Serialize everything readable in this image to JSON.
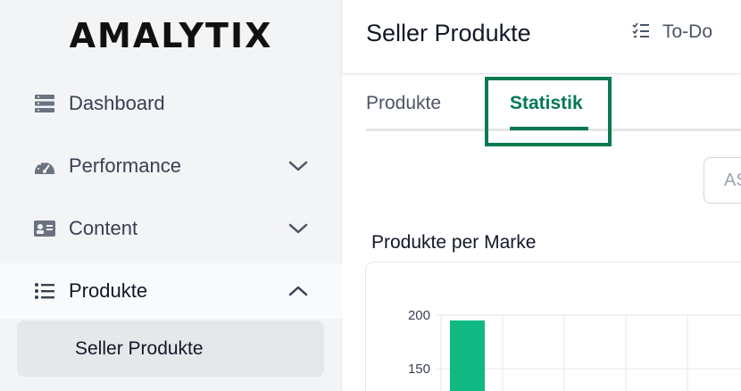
{
  "sidebar": {
    "logo": "AMALYTIX",
    "items": [
      {
        "label": "Dashboard",
        "icon": "server-icon"
      },
      {
        "label": "Performance",
        "icon": "speedometer-icon"
      },
      {
        "label": "Content",
        "icon": "id-card-icon"
      },
      {
        "label": "Produkte",
        "icon": "list-icon"
      }
    ],
    "subitem": {
      "label": "Seller Produkte"
    }
  },
  "header": {
    "title": "Seller Produkte",
    "todo_label": "To-Do"
  },
  "tabs": [
    {
      "label": "Produkte",
      "active": false
    },
    {
      "label": "Statistik",
      "active": true
    }
  ],
  "search": {
    "placeholder": "AS"
  },
  "colors": {
    "accent": "#047857",
    "bar": "#10b981",
    "highlight": "#0a7a4f"
  },
  "chart": {
    "title": "Produkte per Marke"
  },
  "chart_data": {
    "type": "bar",
    "title": "Produkte per Marke",
    "yticks": [
      150,
      200
    ],
    "ylim": [
      100,
      210
    ],
    "values": [
      195
    ],
    "grid": true
  }
}
